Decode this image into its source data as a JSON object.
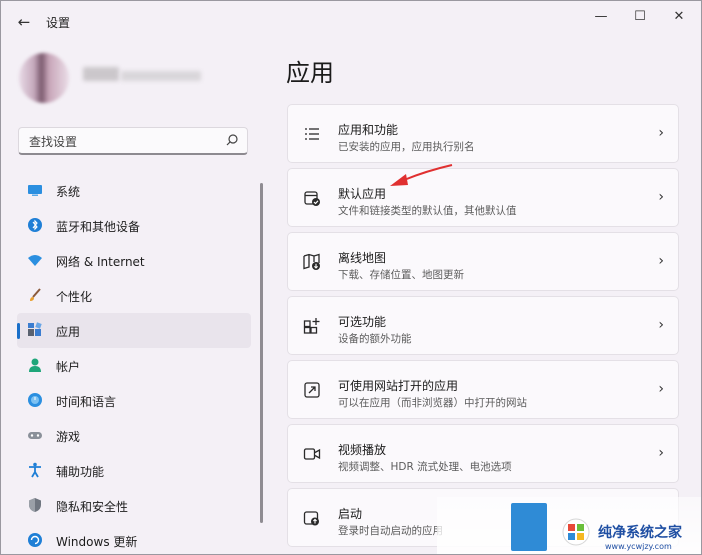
{
  "window": {
    "title": "设置",
    "back_glyph": "←",
    "minimize_glyph": "—",
    "maximize_glyph": "☐",
    "close_glyph": "✕"
  },
  "search": {
    "placeholder": "查找设置"
  },
  "sidebar": {
    "items": [
      {
        "label": "系统",
        "icon": "monitor-icon"
      },
      {
        "label": "蓝牙和其他设备",
        "icon": "bluetooth-icon"
      },
      {
        "label": "网络 & Internet",
        "icon": "wifi-icon"
      },
      {
        "label": "个性化",
        "icon": "brush-icon"
      },
      {
        "label": "应用",
        "icon": "apps-icon",
        "selected": true
      },
      {
        "label": "帐户",
        "icon": "person-icon"
      },
      {
        "label": "时间和语言",
        "icon": "globe-clock-icon"
      },
      {
        "label": "游戏",
        "icon": "gamepad-icon"
      },
      {
        "label": "辅助功能",
        "icon": "accessibility-icon"
      },
      {
        "label": "隐私和安全性",
        "icon": "shield-icon"
      },
      {
        "label": "Windows 更新",
        "icon": "update-icon"
      }
    ]
  },
  "main": {
    "title": "应用",
    "cards": [
      {
        "title": "应用和功能",
        "subtitle": "已安装的应用，应用执行别名",
        "icon": "list-icon"
      },
      {
        "title": "默认应用",
        "subtitle": "文件和链接类型的默认值，其他默认值",
        "icon": "default-apps-icon"
      },
      {
        "title": "离线地图",
        "subtitle": "下载、存储位置、地图更新",
        "icon": "offline-map-icon"
      },
      {
        "title": "可选功能",
        "subtitle": "设备的额外功能",
        "icon": "add-grid-icon"
      },
      {
        "title": "可使用网站打开的应用",
        "subtitle": "可以在应用（而非浏览器）中打开的网站",
        "icon": "open-link-icon"
      },
      {
        "title": "视频播放",
        "subtitle": "视频调整、HDR 流式处理、电池选项",
        "icon": "video-icon"
      },
      {
        "title": "启动",
        "subtitle": "登录时自动启动的应用",
        "icon": "startup-icon"
      }
    ],
    "chevron": "›"
  },
  "watermark": {
    "title": "纯净系统之家",
    "url": "www.ycwjzy.com"
  },
  "colors": {
    "accent": "#1a6fc9",
    "background": "#f4f0f6",
    "annotation_arrow": "#e03030"
  }
}
